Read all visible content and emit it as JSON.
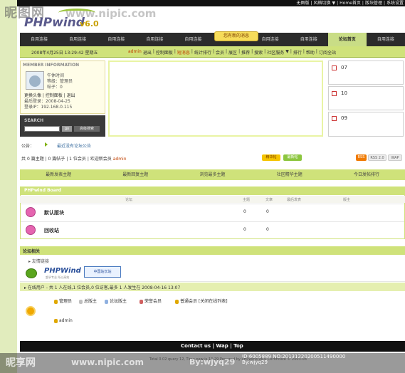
{
  "watermark": {
    "site": "昵图网",
    "url": "www.nipic.com",
    "bottom_site": "昵享网",
    "bottom_url": "www.nipic.com",
    "by": "By:wjyq29",
    "id_line1": "ID:6005889 NO:20131220200511490000",
    "id_line2": "By:wjyq29"
  },
  "top_links": [
    "无图版",
    "|",
    "风格切换",
    "▼",
    "|",
    "Home首页",
    "|",
    "版块管理",
    "|",
    "系统设置"
  ],
  "logo": {
    "text": "PHPwind",
    "version": "v6.0"
  },
  "nav": {
    "items": [
      "自用连接",
      "自用连接",
      "自用连接",
      "自用连接",
      "自用连接",
      "自用连接",
      "自用连接",
      "自用连接",
      "论坛首页",
      "自用连接"
    ]
  },
  "new_message": "您有新的消息",
  "infobar": {
    "date": "2008年4月25日 13:29:42",
    "weekday": "星期五",
    "links": [
      "admin",
      "退出",
      "|",
      "控制面板",
      "|",
      "短消息",
      "|",
      "统计排行",
      "|",
      "会员",
      "|",
      "展区",
      "|",
      "推荐",
      "|",
      "搜索",
      "|",
      "社区服务",
      "▼",
      "|",
      "排行",
      "|",
      "帮助",
      "|",
      "订阅全站"
    ]
  },
  "member": {
    "title": "MEMBER  INFORMATION",
    "greeting": "午休时间",
    "level": "等级：管理员",
    "coins": "帖子：0",
    "links": "更换头像 | 控制面板 | 退出",
    "last_visit": "最后登录：2008-04-25",
    "ip": "登录IP：192.168.0.115"
  },
  "search": {
    "title": "SEARCH",
    "go": "go",
    "advanced": "高级搜索"
  },
  "side_cards": [
    "07",
    "10",
    "09"
  ],
  "notice": {
    "label": "公告：",
    "text": "最近没有论坛公告"
  },
  "stats": {
    "prefix": "共",
    "topics_num": "0",
    "topics": "篇主题",
    "posts_num": "0",
    "posts": "篇帖子",
    "members_num": "1",
    "members": "位会员",
    "welcome": "欢迎新会员",
    "newest": "admin"
  },
  "stat_tags": [
    "精华帖",
    "最新帖"
  ],
  "rss_tags": [
    "RSS",
    "RSS 2.0",
    "WAP"
  ],
  "tabs": [
    "最新发表主题",
    "最新回复主题",
    "浏览最多主题",
    "社区精华主题",
    "今日发帖排行"
  ],
  "board": {
    "title": "PHPwind Board",
    "cols": [
      "论坛",
      "主题",
      "文章",
      "最后发表",
      "版主"
    ],
    "rows": [
      {
        "name": "默认版块",
        "topics": "0",
        "posts": "0"
      },
      {
        "name": "回收站",
        "topics": "0",
        "posts": "0"
      }
    ]
  },
  "links": {
    "title": "论坛相关",
    "sub": "▸ 友情链接",
    "pw_logo": "PHPWind",
    "pw_sub": "超乎专业 所以高效",
    "cz": "中国站长站"
  },
  "online": {
    "text": "▸ 在线用户 - 共 1 人在线,1 位会员,0 位访客,最多 1 人发生在 2008-04-16 13:07",
    "groups": [
      "管理员",
      "总版主",
      "论坛版主",
      "荣誉会员",
      "普通会员 [关闭在线列表]"
    ],
    "user": "admin"
  },
  "footer": {
    "links": "Contact us | Wap | Top",
    "copy": "Total 0.02 query 12, Time now is 13:29   Powered by PHPWind v6.0 Certificate © 2003-08"
  },
  "colors": {
    "accent": "#cfe27a",
    "dark": "#2b2b2b",
    "sidebar": "#e1ecbd"
  }
}
